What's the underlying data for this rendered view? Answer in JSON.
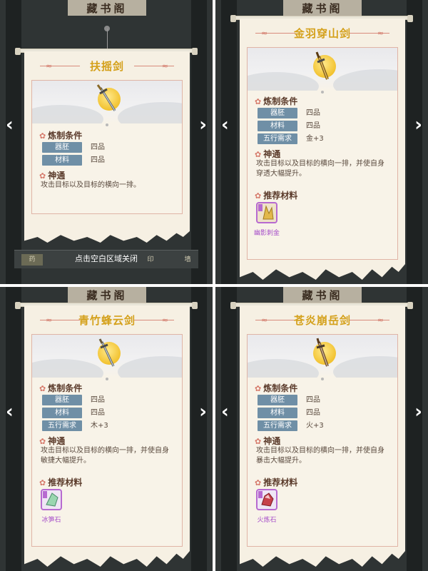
{
  "nav": {
    "prev_arrow": "‹",
    "next_arrow": "›"
  },
  "background": {
    "sign_text": "藏书阁"
  },
  "colors": {
    "title_gold": "#d4a01a",
    "pill_blue": "#6f8fa6",
    "material_purple": "#a64dc9",
    "flower_red": "#d67a6b"
  },
  "cards": [
    {
      "title": "扶摇剑",
      "section_craft": "炼制条件",
      "rows": [
        {
          "label": "器胚",
          "value": "四品"
        },
        {
          "label": "材料",
          "value": "四品"
        }
      ],
      "section_skill": "神通",
      "skill_desc": "攻击目标以及目标的横向一排。",
      "close_hint": "点击空白区域关闭",
      "bottom_tabs": [
        "药",
        "印",
        "墙"
      ]
    },
    {
      "title": "金羽穿山剑",
      "section_craft": "炼制条件",
      "rows": [
        {
          "label": "器胚",
          "value": "四品"
        },
        {
          "label": "材料",
          "value": "四品"
        },
        {
          "label": "五行需求",
          "value": "金+3"
        }
      ],
      "section_skill": "神通",
      "skill_desc": "攻击目标以及目标的横向一排，并使自身穿透大幅提升。",
      "section_materials": "推荐材料",
      "material_name": "幽影刺金",
      "material_icon": "gold-crystal-icon"
    },
    {
      "title": "青竹蜂云剑",
      "section_craft": "炼制条件",
      "rows": [
        {
          "label": "器胚",
          "value": "四品"
        },
        {
          "label": "材料",
          "value": "四品"
        },
        {
          "label": "五行需求",
          "value": "木+3"
        }
      ],
      "section_skill": "神通",
      "skill_desc": "攻击目标以及目标的横向一排，并使自身敏捷大幅提升。",
      "section_materials": "推荐材料",
      "material_name": "冰笋石",
      "material_icon": "green-crystal-icon"
    },
    {
      "title": "苍炎崩岳剑",
      "section_craft": "炼制条件",
      "rows": [
        {
          "label": "器胚",
          "value": "四品"
        },
        {
          "label": "材料",
          "value": "四品"
        },
        {
          "label": "五行需求",
          "value": "火+3"
        }
      ],
      "section_skill": "神通",
      "skill_desc": "攻击目标以及目标的横向一排，并使自身暴击大幅提升。",
      "section_materials": "推荐材料",
      "material_name": "火炼石",
      "material_icon": "red-crystal-icon"
    }
  ]
}
